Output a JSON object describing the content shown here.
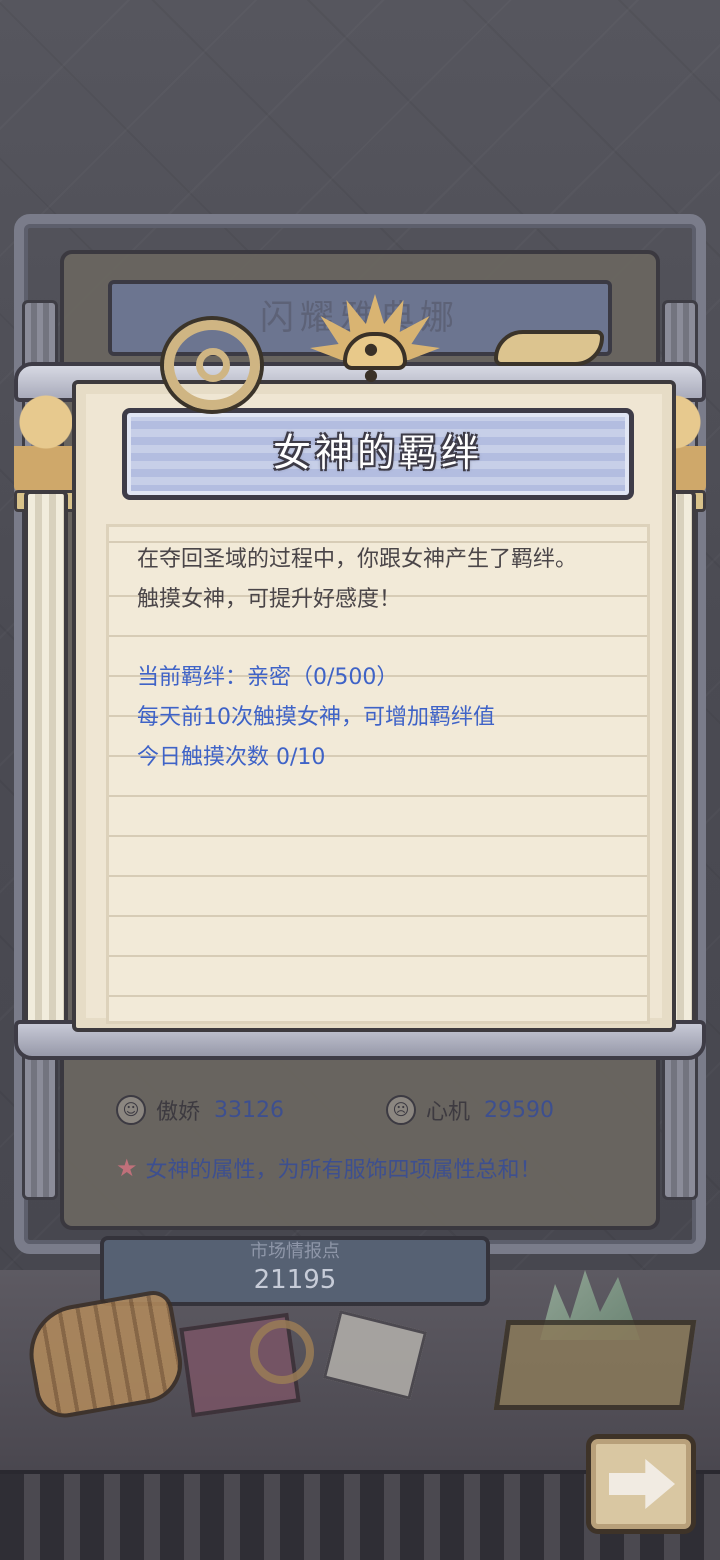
{
  "modal": {
    "title": "女神的羁绊",
    "description_line1": "在夺回圣域的过程中，你跟女神产生了羁绊。",
    "description_line2": "触摸女神，可提升好感度！",
    "bond_status": "当前羁绊：亲密（0/500）",
    "daily_rule": "每天前10次触摸女神，可增加羁绊值",
    "today_touches": "今日触摸次数  0/10"
  },
  "background": {
    "panel_title": "闪耀雅典娜",
    "stats": [
      {
        "icon": "halo-face-icon",
        "label": "傲娇",
        "value": "33126"
      },
      {
        "icon": "devil-face-icon",
        "label": "心机",
        "value": "29590"
      }
    ],
    "attribute_note": "女神的属性，为所有服饰四项属性总和！",
    "score_caption": "市场情报点",
    "score_value": "21195"
  },
  "colors": {
    "accent_blue": "#3f63c7",
    "paper": "#efe6d3",
    "banner": "#b3bde0"
  }
}
